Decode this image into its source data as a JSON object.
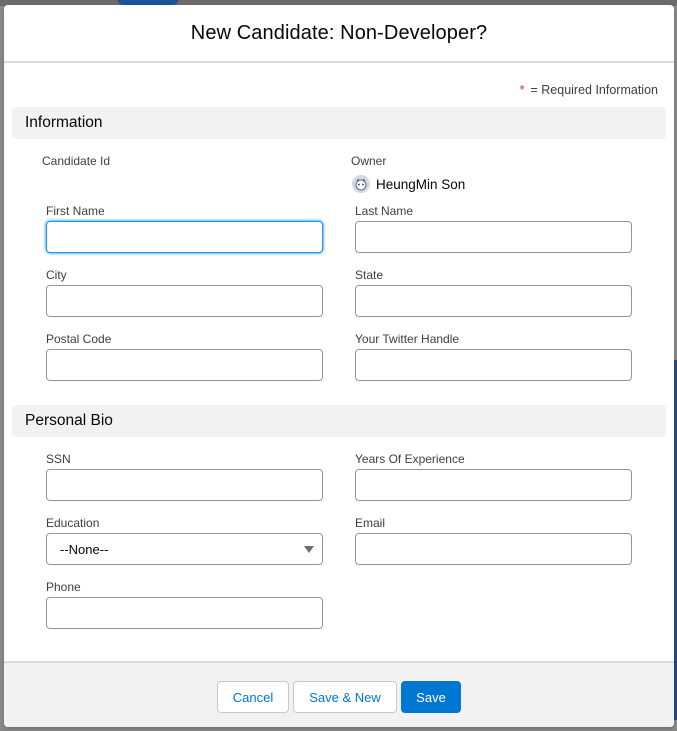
{
  "modal": {
    "title": "New Candidate: Non-Developer?"
  },
  "legend": {
    "star": "*",
    "text": "= Required Information"
  },
  "sections": {
    "information": {
      "title": "Information"
    },
    "personal_bio": {
      "title": "Personal Bio"
    }
  },
  "fields": {
    "candidate_id": {
      "label": "Candidate Id"
    },
    "owner": {
      "label": "Owner",
      "value": "HeungMin Son",
      "icon": "user-avatar-icon"
    },
    "first_name": {
      "label": "First Name",
      "value": ""
    },
    "last_name": {
      "label": "Last Name",
      "value": ""
    },
    "city": {
      "label": "City",
      "value": ""
    },
    "state": {
      "label": "State",
      "value": ""
    },
    "postal_code": {
      "label": "Postal Code",
      "value": ""
    },
    "twitter_handle": {
      "label": "Your Twitter Handle",
      "value": ""
    },
    "ssn": {
      "label": "SSN",
      "value": ""
    },
    "years_experience": {
      "label": "Years Of Experience",
      "value": ""
    },
    "education": {
      "label": "Education",
      "value": "--None--"
    },
    "email": {
      "label": "Email",
      "value": ""
    },
    "phone": {
      "label": "Phone",
      "value": ""
    }
  },
  "footer": {
    "cancel_label": "Cancel",
    "save_new_label": "Save & New",
    "save_label": "Save"
  },
  "colors": {
    "brand": "#0176d3",
    "required": "#c23934",
    "focus": "#1b96ff"
  }
}
